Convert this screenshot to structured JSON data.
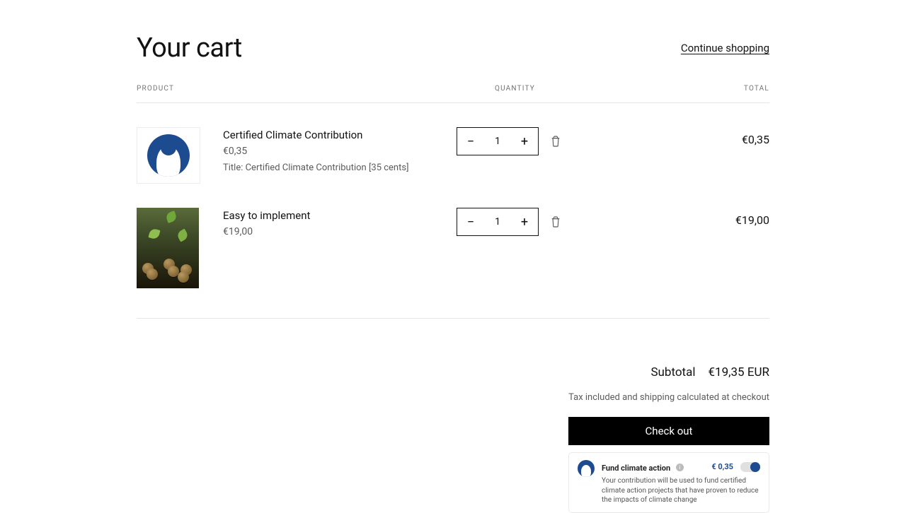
{
  "header": {
    "title": "Your cart",
    "continue": "Continue shopping"
  },
  "columns": {
    "product": "PRODUCT",
    "quantity": "QUANTITY",
    "total": "TOTAL"
  },
  "items": [
    {
      "name": "Certified Climate Contribution",
      "price": "€0,35",
      "variant": "Title: Certified Climate Contribution [35 cents]",
      "qty": "1",
      "total": "€0,35",
      "image": "penguin"
    },
    {
      "name": "Easy to implement",
      "price": "€19,00",
      "variant": "",
      "qty": "1",
      "total": "€19,00",
      "image": "plants"
    }
  ],
  "summary": {
    "subtotal_label": "Subtotal",
    "subtotal_value": "€19,35 EUR",
    "tax_note": "Tax included and shipping calculated at checkout",
    "checkout": "Check out"
  },
  "climate": {
    "title": "Fund climate action",
    "amount": "€ 0,35",
    "desc": "Your contribution will be used to fund certified climate action projects that have proven to reduce the impacts of climate change"
  }
}
